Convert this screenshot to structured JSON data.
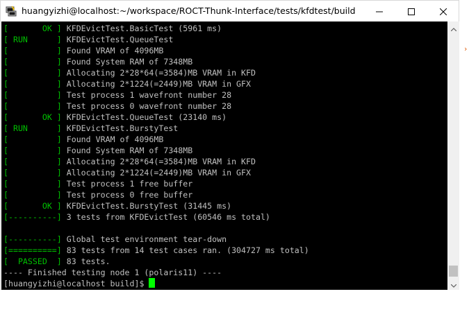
{
  "window": {
    "title": "huangyizhi@localhost:~/workspace/ROCT-Thunk-Interface/tests/kfdtest/build",
    "icon": "putty-terminal-icon"
  },
  "terminal": {
    "lines": [
      {
        "tag": "[       OK ]",
        "text": " KFDEvictTest.BasicTest (5961 ms)"
      },
      {
        "tag": "[ RUN      ]",
        "text": " KFDEvictTest.QueueTest"
      },
      {
        "tag": "[          ]",
        "text": " Found VRAM of 4096MB"
      },
      {
        "tag": "[          ]",
        "text": " Found System RAM of 7348MB"
      },
      {
        "tag": "[          ]",
        "text": " Allocating 2*28*64(=3584)MB VRAM in KFD"
      },
      {
        "tag": "[          ]",
        "text": " Allocating 2*1224(=2449)MB VRAM in GFX"
      },
      {
        "tag": "[          ]",
        "text": " Test process 1 wavefront number 28"
      },
      {
        "tag": "[          ]",
        "text": " Test process 0 wavefront number 28"
      },
      {
        "tag": "[       OK ]",
        "text": " KFDEvictTest.QueueTest (23140 ms)"
      },
      {
        "tag": "[ RUN      ]",
        "text": " KFDEvictTest.BurstyTest"
      },
      {
        "tag": "[          ]",
        "text": " Found VRAM of 4096MB"
      },
      {
        "tag": "[          ]",
        "text": " Found System RAM of 7348MB"
      },
      {
        "tag": "[          ]",
        "text": " Allocating 2*28*64(=3584)MB VRAM in KFD"
      },
      {
        "tag": "[          ]",
        "text": " Allocating 2*1224(=2449)MB VRAM in GFX"
      },
      {
        "tag": "[          ]",
        "text": " Test process 1 free buffer"
      },
      {
        "tag": "[          ]",
        "text": " Test process 0 free buffer"
      },
      {
        "tag": "[       OK ]",
        "text": " KFDEvictTest.BurstyTest (31445 ms)"
      },
      {
        "tag": "[----------]",
        "text": " 3 tests from KFDEvictTest (60546 ms total)"
      },
      {
        "tag": "",
        "text": ""
      },
      {
        "tag": "[----------]",
        "text": " Global test environment tear-down"
      },
      {
        "tag": "[==========]",
        "text": " 83 tests from 14 test cases ran. (304727 ms total)"
      },
      {
        "tag": "[  PASSED  ]",
        "text": " 83 tests."
      },
      {
        "tag": "",
        "text": "---- Finished testing node 1 (polaris11) ----"
      },
      {
        "tag": "",
        "text": "[huangyizhi@localhost build]$ "
      }
    ]
  },
  "colors": {
    "terminal_bg": "#000000",
    "terminal_fg": "#c0c0c0",
    "status_tag": "#00c000",
    "cursor": "#00ff00"
  }
}
